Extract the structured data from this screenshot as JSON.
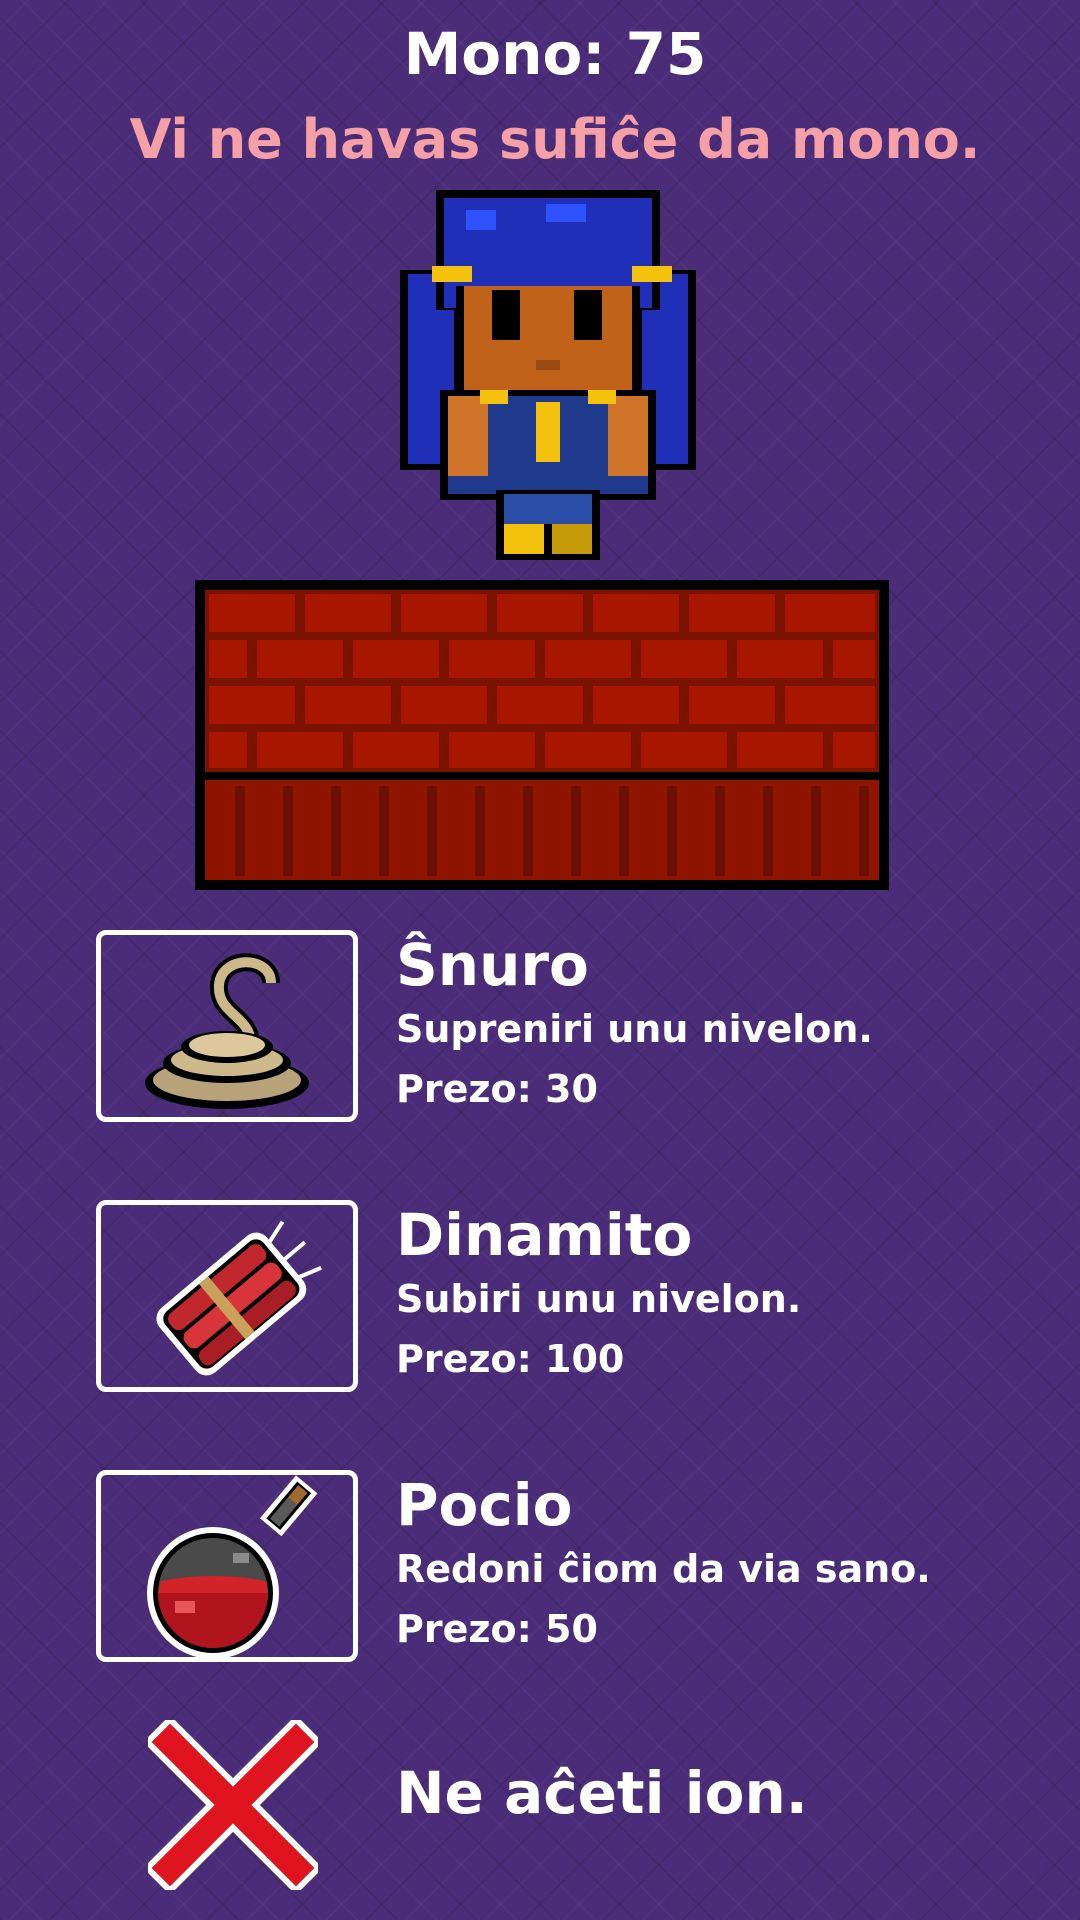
{
  "hud": {
    "money_text": "Mono: 75",
    "warning_text": "Vi ne havas sufiĉe da mono."
  },
  "shop": {
    "items": [
      {
        "icon": "rope-icon",
        "name": "Ŝnuro",
        "description": "Supreniri unu nivelon.",
        "price_text": "Prezo: 30"
      },
      {
        "icon": "dynamite-icon",
        "name": "Dinamito",
        "description": "Subiri unu nivelon.",
        "price_text": "Prezo: 100"
      },
      {
        "icon": "potion-icon",
        "name": "Pocio",
        "description": "Redoni ĉiom da via sano.",
        "price_text": "Prezo: 50"
      }
    ],
    "cancel": {
      "icon": "close-x-icon",
      "label": "Ne aĉeti ion."
    }
  },
  "colors": {
    "background": "#4a2c78",
    "warning": "#f5a0a6",
    "brick": "#a81600",
    "hair": "#1f2fb8",
    "cancel_x": "#e0141e"
  }
}
